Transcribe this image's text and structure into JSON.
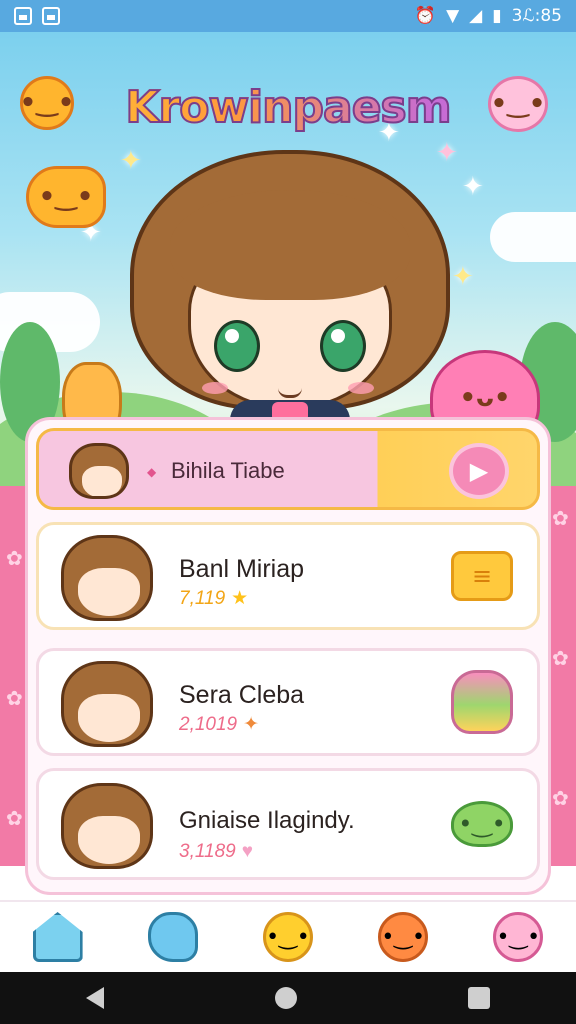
{
  "status_bar": {
    "time": "3ℒ:85",
    "icons": [
      "image-icon",
      "gallery-icon",
      "alarm-icon",
      "wifi-icon",
      "signal-icon",
      "battery-icon"
    ]
  },
  "app": {
    "title": "Krowinpaesm"
  },
  "featured": {
    "title": "Bihila Tiabe",
    "action_icon": "play-icon"
  },
  "list": [
    {
      "name": "Banl Miriap",
      "score": "7,119",
      "icon": "note-icon"
    },
    {
      "name": "Sera Cleba",
      "score": "2,1019",
      "icon": "candy-jar-icon"
    },
    {
      "name": "Gniaise Ilagindy.",
      "score": "3,1189",
      "icon": "slime-icon"
    }
  ],
  "bottom_nav": [
    "home-icon",
    "blob-icon",
    "sun-mascot-icon",
    "orange-mascot-icon",
    "pink-bear-icon"
  ],
  "colors": {
    "status_bar": "#58a9e0",
    "accent_pink": "#f27aa6",
    "accent_yellow": "#ffc93d"
  }
}
